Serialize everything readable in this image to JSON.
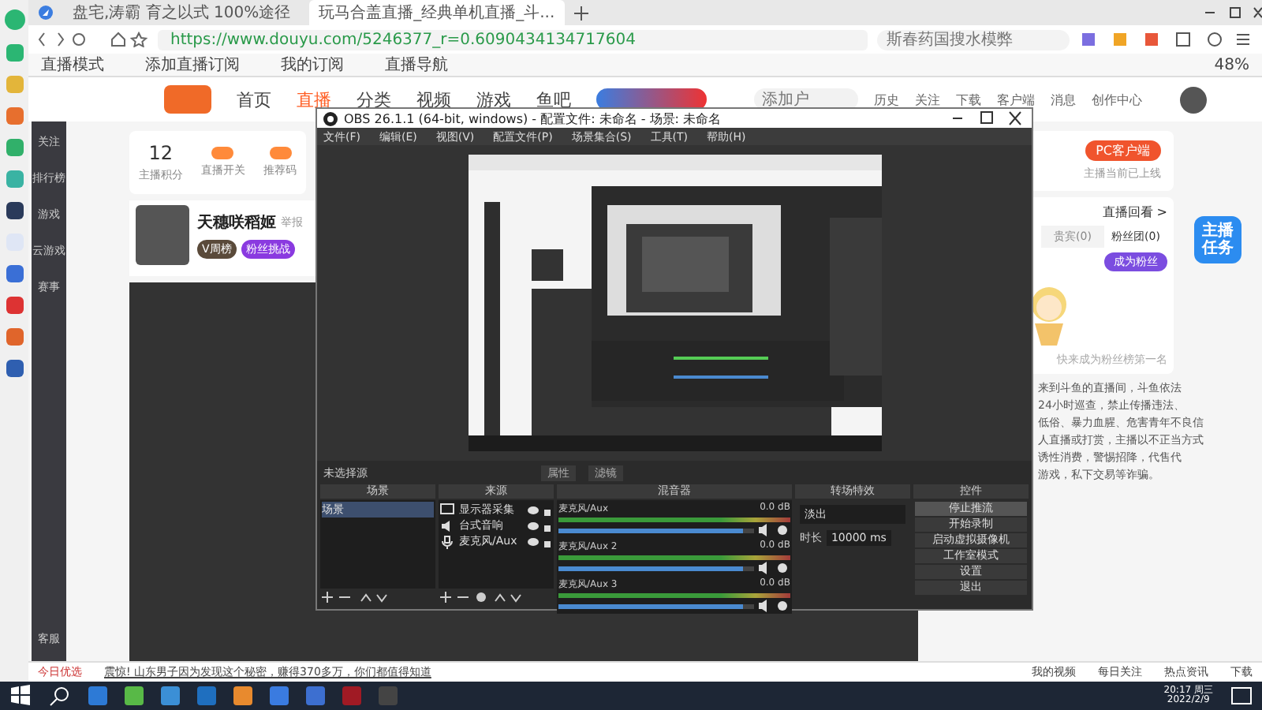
{
  "browser": {
    "tabs": [
      {
        "title": "盘宅,涛霸 育之以式 100%途径",
        "selected": false
      },
      {
        "title": "玩马合盖直播_经典单机直播_斗...",
        "selected": true
      }
    ],
    "url": "https://www.douyu.com/5246377_r=0.6090434134717604",
    "search": {
      "placeholder": "斯春药国搜水模弊"
    },
    "bookmarks": [
      "直播模式",
      "添加直播订阅",
      "我的订阅",
      "直播导航"
    ],
    "battery": "48%"
  },
  "site": {
    "nav": [
      {
        "label": "首页",
        "selected": false
      },
      {
        "label": "直播",
        "selected": true
      },
      {
        "label": "分类",
        "selected": false
      },
      {
        "label": "视频",
        "selected": false
      },
      {
        "label": "游戏",
        "selected": false
      },
      {
        "label": "鱼吧",
        "selected": false
      }
    ],
    "search": {
      "placeholder": "添加户"
    },
    "header_icons": [
      "历史",
      "关注",
      "下载",
      "客户端",
      "消息",
      "创作中心"
    ],
    "sidebar": [
      "关注",
      "排行榜",
      "游戏",
      "云游戏",
      "赛事"
    ],
    "sidebar_bottom": "客服",
    "stats": [
      {
        "value": "12",
        "label": "主播积分"
      },
      {
        "label": "直播开关"
      },
      {
        "label": "推荐码"
      }
    ],
    "streamer": {
      "name": "天穗咲稻姬",
      "report": "举报",
      "badges": [
        "V周榜",
        "粉丝挑战"
      ]
    },
    "client_button": "PC客户端",
    "client_note": "主播当前已上线",
    "replay": "直播回看 >",
    "rank_tabs": [
      {
        "label": "贵宾(0)",
        "selected": false
      },
      {
        "label": "粉丝团(0)",
        "selected": true
      }
    ],
    "fan_button": "成为粉丝",
    "fan_note": "快来成为粉丝榜第一名",
    "task_badge": "主播任务",
    "notice": [
      "来到斗鱼的直播间，斗鱼依法",
      "24小时巡查，禁止传播违法、",
      "低俗、暴力血腥、危害青年不良信",
      "人直播或打赏，主播以不正当方式",
      "诱性消费，警惕招降，代售代",
      "游戏，私下交易等诈骗。"
    ]
  },
  "obs": {
    "title": "OBS 26.1.1 (64-bit, windows) - 配置文件: 未命名 - 场景: 未命名",
    "menu": [
      "文件(F)",
      "编辑(E)",
      "视图(V)",
      "配置文件(P)",
      "场景集合(S)",
      "工具(T)",
      "帮助(H)"
    ],
    "source_bar": {
      "label": "未选择源",
      "buttons": [
        "属性",
        "滤镜"
      ]
    },
    "docks": {
      "scenes": "场景",
      "sources": "来源",
      "mixer": "混音器",
      "transitions": "转场特效",
      "controls": "控件"
    },
    "scenes": [
      {
        "name": "场景",
        "selected": true
      }
    ],
    "sources": [
      {
        "name": "显示器采集",
        "kind": "display"
      },
      {
        "name": "台式音响",
        "kind": "speaker"
      },
      {
        "name": "麦克风/Aux",
        "kind": "mic"
      }
    ],
    "channels": [
      {
        "name": "麦克风/Aux",
        "reading": "0.0 dB",
        "level": 0.94
      },
      {
        "name": "麦克风/Aux 2",
        "reading": "0.0 dB",
        "level": 0.94
      },
      {
        "name": "麦克风/Aux 3",
        "reading": "0.0 dB",
        "level": 0.94
      }
    ],
    "transition": {
      "value": "淡出",
      "duration_label": "时长",
      "duration": "10000 ms"
    },
    "controls": [
      {
        "label": "停止推流",
        "active": true
      },
      {
        "label": "开始录制",
        "active": false
      },
      {
        "label": "启动虚拟摄像机",
        "active": false
      },
      {
        "label": "工作室模式",
        "active": false
      },
      {
        "label": "设置",
        "active": false
      },
      {
        "label": "退出",
        "active": false
      }
    ]
  },
  "status_bar": {
    "left": "今日优选",
    "news": "震惊! 山东男子因为发现这个秘密，赚得370多万，你们都值得知道",
    "right": [
      "我的视频",
      "每日关注",
      "热点资讯",
      "下载"
    ]
  },
  "taskbar": {
    "time": "20:17 周三",
    "date": "2022/2/9"
  }
}
